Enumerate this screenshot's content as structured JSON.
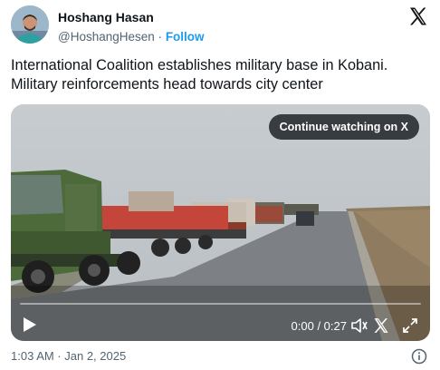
{
  "author": {
    "name": "Hoshang Hasan",
    "handle": "@HoshangHesen",
    "separator": "·",
    "follow_label": "Follow",
    "avatar_icon": "profile-photo"
  },
  "brand": {
    "logo_icon": "x-logo"
  },
  "tweet": {
    "text": "International Coalition establishes military base in Kobani. Military reinforcements head towards city center"
  },
  "media": {
    "continue_label": "Continue watching on X",
    "time": "0:00 / 0:27",
    "progress": 0,
    "controls": {
      "play_icon": "play-icon",
      "volume_icon": "volume-icon",
      "x_icon": "x-icon",
      "fullscreen_icon": "fullscreen-icon"
    }
  },
  "footer": {
    "timestamp": "1:03 AM · Jan 2, 2025",
    "info_icon": "info-icon"
  },
  "colors": {
    "link": "#1d9bf0",
    "text": "#0f1419",
    "secondary": "#536471"
  }
}
